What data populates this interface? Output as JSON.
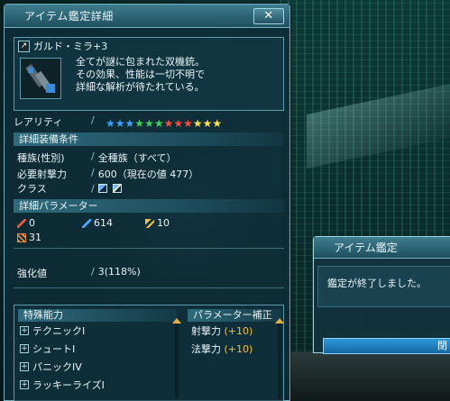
{
  "window": {
    "title": "アイテム鑑定詳細",
    "close_label": "✕"
  },
  "item": {
    "name": "ガルド・ミラ+3",
    "description": "全てが謎に包まれた双機銃。\nその効果、性能は一切不明で\n詳細な解析が待たれている。"
  },
  "rarity": {
    "label": "レアリティ",
    "stars": [
      {
        "color": "#3aa0ff"
      },
      {
        "color": "#3aa0ff"
      },
      {
        "color": "#3aa0ff"
      },
      {
        "color": "#3ed05a"
      },
      {
        "color": "#3ed05a"
      },
      {
        "color": "#3ed05a"
      },
      {
        "color": "#ff4b3a"
      },
      {
        "color": "#ff4b3a"
      },
      {
        "color": "#ff4b3a"
      },
      {
        "color": "#ffe04a"
      },
      {
        "color": "#ffe04a"
      },
      {
        "color": "#ffe04a"
      }
    ]
  },
  "equip_conditions": {
    "header": "詳細装備条件",
    "race_label": "種族(性別)",
    "race_value": "全種族（すべて）",
    "requirement_label": "必要射撃力",
    "requirement_value": "600（現在の値 477）",
    "class_label": "クラス"
  },
  "parameters": {
    "header": "詳細パラメーター",
    "stats": [
      {
        "value": "0",
        "icon": "sword-icon",
        "color": "#e05a3a"
      },
      {
        "value": "614",
        "icon": "gun-icon",
        "color": "#4aa8ff"
      },
      {
        "value": "10",
        "icon": "wand-icon",
        "color": "#f0c040"
      },
      {
        "value": "31",
        "icon": "dex-icon",
        "color": "#e08a3a"
      }
    ]
  },
  "grind": {
    "label": "強化値",
    "value": "3(118%)"
  },
  "abilities": {
    "header": "特殊能力",
    "items": [
      "テクニックI",
      "シュートI",
      "パニックIV",
      "ラッキーライズI"
    ]
  },
  "bonus": {
    "header": "パラメーター補正",
    "items": [
      {
        "label": "射撃力",
        "value": "(+10)"
      },
      {
        "label": "法撃力",
        "value": "(+10)"
      }
    ]
  },
  "popup": {
    "title": "アイテム鑑定",
    "message": "鑑定が終了しました。",
    "button_label": "閉"
  }
}
